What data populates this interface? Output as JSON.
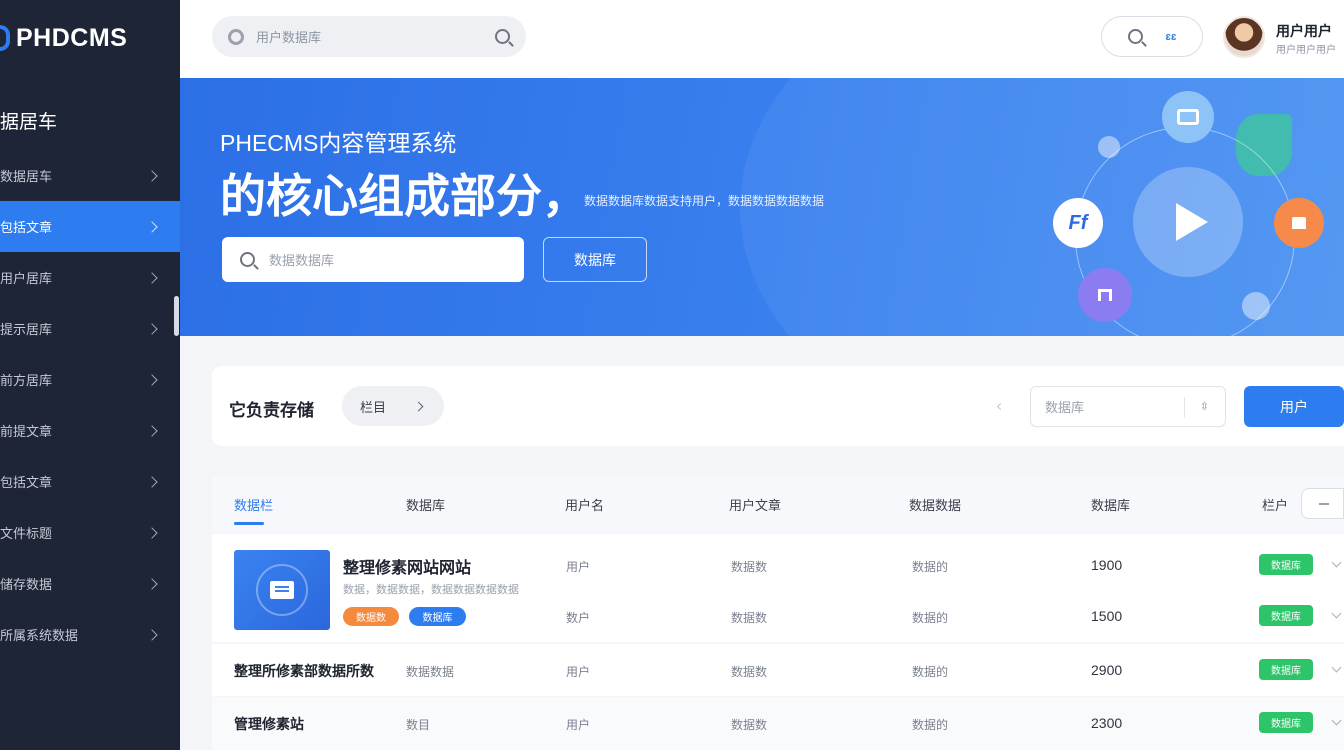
{
  "app": {
    "logo_text": "PHDCMS"
  },
  "sidebar": {
    "heading": "据居车",
    "items": [
      {
        "label": "数据居车",
        "active": false
      },
      {
        "label": "包括文章",
        "active": true
      },
      {
        "label": "用户居库",
        "active": false
      },
      {
        "label": "提示居库",
        "active": false
      },
      {
        "label": "前方居库",
        "active": false
      },
      {
        "label": "前提文章",
        "active": false
      },
      {
        "label": "包括文章",
        "active": false
      },
      {
        "label": "文件标题",
        "active": false
      },
      {
        "label": "储存数据",
        "active": false
      },
      {
        "label": "所属系统数据",
        "active": false
      }
    ]
  },
  "topbar": {
    "search_placeholder": "用户数据库",
    "pill_code": "ԑԑ",
    "user_name": "用户用户",
    "user_sub": "用户用户用户"
  },
  "banner": {
    "subtitle": "PHECMS内容管理系统",
    "title": "的核心组成部分，",
    "description": "数据数据库数据支持用户，数据数据数据数据",
    "input_placeholder": "数据数据库",
    "button_label": "数据库",
    "node_left_label": "Ff"
  },
  "filter": {
    "title": "它负责存储",
    "chip_label": "栏目",
    "select_placeholder": "数据库",
    "select_arrow": "⇳",
    "button_label": "用户"
  },
  "table": {
    "headers": [
      "数据栏",
      "数据库",
      "用户名",
      "用户文章",
      "数据数据",
      "数据库",
      "栏户"
    ],
    "rows": [
      {
        "title": "整理修素网站网站",
        "desc": "数据，数据数据，数据数据数据数据",
        "tags": [
          "数据数",
          "数据库"
        ],
        "lines": [
          {
            "col3": "用户",
            "col4": "数据数",
            "col5": "数据的",
            "value": "1900",
            "status": "数据库"
          },
          {
            "col3": "数户",
            "col4": "数据数",
            "col5": "数据的",
            "value": "1500",
            "status": "数据库"
          }
        ]
      },
      {
        "title": "整理所修素部数据所数",
        "col2": "数据数据",
        "col3": "用户",
        "col4": "数据数",
        "col5": "数据的",
        "value": "2900",
        "status": "数据库"
      },
      {
        "title": "管理修素站",
        "col2": "数目",
        "col3": "用户",
        "col4": "数据数",
        "col5": "数据的",
        "value": "2300",
        "status": "数据库"
      }
    ]
  },
  "colors": {
    "accent": "#2d7cf0",
    "sidebar_bg": "#1e2536",
    "status_green": "#2ec46a",
    "tag_orange": "#f5893c"
  },
  "icons": [
    "search-icon",
    "gear-icon",
    "play-icon",
    "chevron-right-icon",
    "chevron-down-icon",
    "document-icon",
    "house-icon"
  ]
}
